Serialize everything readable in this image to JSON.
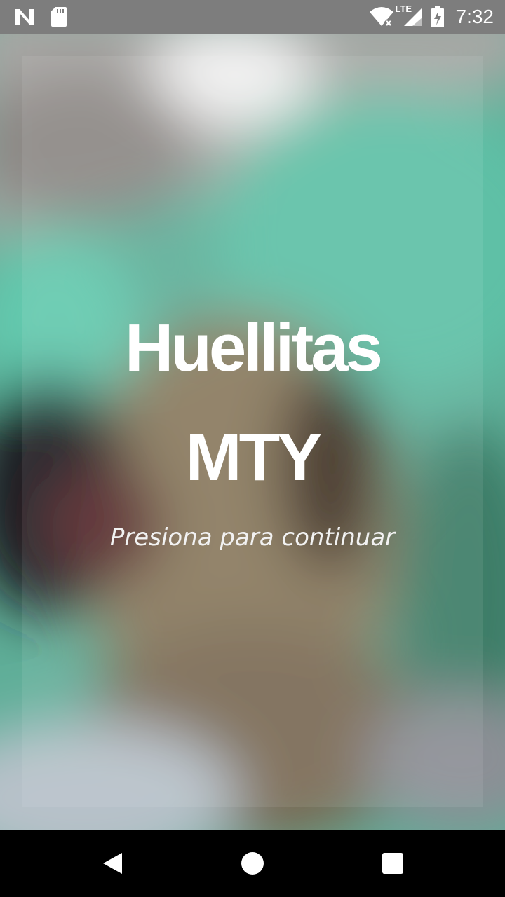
{
  "status_bar": {
    "time": "7:32",
    "left_icons": [
      "n-logo-icon",
      "sd-card-icon"
    ],
    "right_icons": [
      "wifi-icon",
      "lte-signal-icon",
      "battery-charging-icon"
    ],
    "network_label": "LTE"
  },
  "splash": {
    "title_line1": "Huellitas",
    "title_line2": "MTY",
    "tap_hint": "Presiona para continuar"
  },
  "nav_bar": {
    "buttons": [
      "back",
      "home",
      "recents"
    ]
  },
  "colors": {
    "status_bar_bg": "#7d7d7d",
    "background_teal": "#5fae98",
    "title_text": "#ffffff"
  }
}
